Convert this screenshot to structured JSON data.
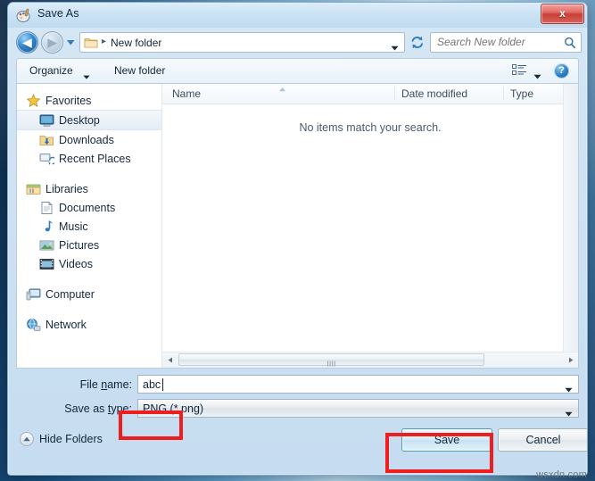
{
  "window": {
    "title": "Save As",
    "icon": "paint-palette-icon",
    "close_label": "x"
  },
  "nav": {
    "back_label": "◀",
    "forward_label": "▶",
    "recent_dropdown_icon": "chevron-down-icon",
    "address": {
      "folder_icon": "folder-icon",
      "separator": "▸",
      "path": "New folder",
      "dropdown_icon": "chevron-down-icon"
    },
    "refresh_icon": "refresh-icon",
    "search": {
      "placeholder": "Search New folder",
      "value": "",
      "icon": "search-icon"
    }
  },
  "toolbar": {
    "organize_label": "Organize",
    "organize_caret_icon": "caret-down-icon",
    "new_folder_label": "New folder",
    "view_icon": "list-view-icon",
    "view_caret_icon": "caret-down-icon",
    "help_icon": "help-icon",
    "help_label": "?"
  },
  "sidebar": {
    "groups": [
      {
        "label": "Favorites",
        "icon": "star-icon",
        "items": [
          {
            "label": "Desktop",
            "icon": "desktop-icon",
            "selected": true
          },
          {
            "label": "Downloads",
            "icon": "downloads-icon",
            "selected": false
          },
          {
            "label": "Recent Places",
            "icon": "recent-places-icon",
            "selected": false
          }
        ]
      },
      {
        "label": "Libraries",
        "icon": "libraries-icon",
        "items": [
          {
            "label": "Documents",
            "icon": "documents-icon",
            "selected": false
          },
          {
            "label": "Music",
            "icon": "music-icon",
            "selected": false
          },
          {
            "label": "Pictures",
            "icon": "pictures-icon",
            "selected": false
          },
          {
            "label": "Videos",
            "icon": "videos-icon",
            "selected": false
          }
        ]
      },
      {
        "label": "Computer",
        "icon": "computer-icon",
        "items": []
      },
      {
        "label": "Network",
        "icon": "network-icon",
        "items": []
      }
    ]
  },
  "filelist": {
    "columns": [
      {
        "label": "Name"
      },
      {
        "label": "Date modified"
      },
      {
        "label": "Type"
      }
    ],
    "sort_indicator_icon": "sort-ascending-icon",
    "empty_message": "No items match your search.",
    "rows": [],
    "scroll_left_icon": "scroll-left-arrow-icon",
    "scroll_right_icon": "scroll-right-arrow-icon"
  },
  "form": {
    "filename_label_pre": "File ",
    "filename_label_key": "n",
    "filename_label_post": "ame:",
    "filename_value": "abc",
    "filename_dropdown_icon": "chevron-down-icon",
    "savetype_label_pre": "Save as ",
    "savetype_label_key": "t",
    "savetype_label_post": "ype:",
    "savetype_value": "PNG (*.png)",
    "savetype_dropdown_icon": "chevron-down-icon"
  },
  "footer": {
    "hide_folders_label": "Hide Folders",
    "hide_folders_icon": "chevron-up-circle-icon",
    "save_label": "Save",
    "cancel_label": "Cancel"
  },
  "watermark": "wsxdn.com",
  "colors": {
    "annotation": "#ef1d1d",
    "close_button": "#c83f35",
    "accent": "#2b7fc4"
  }
}
